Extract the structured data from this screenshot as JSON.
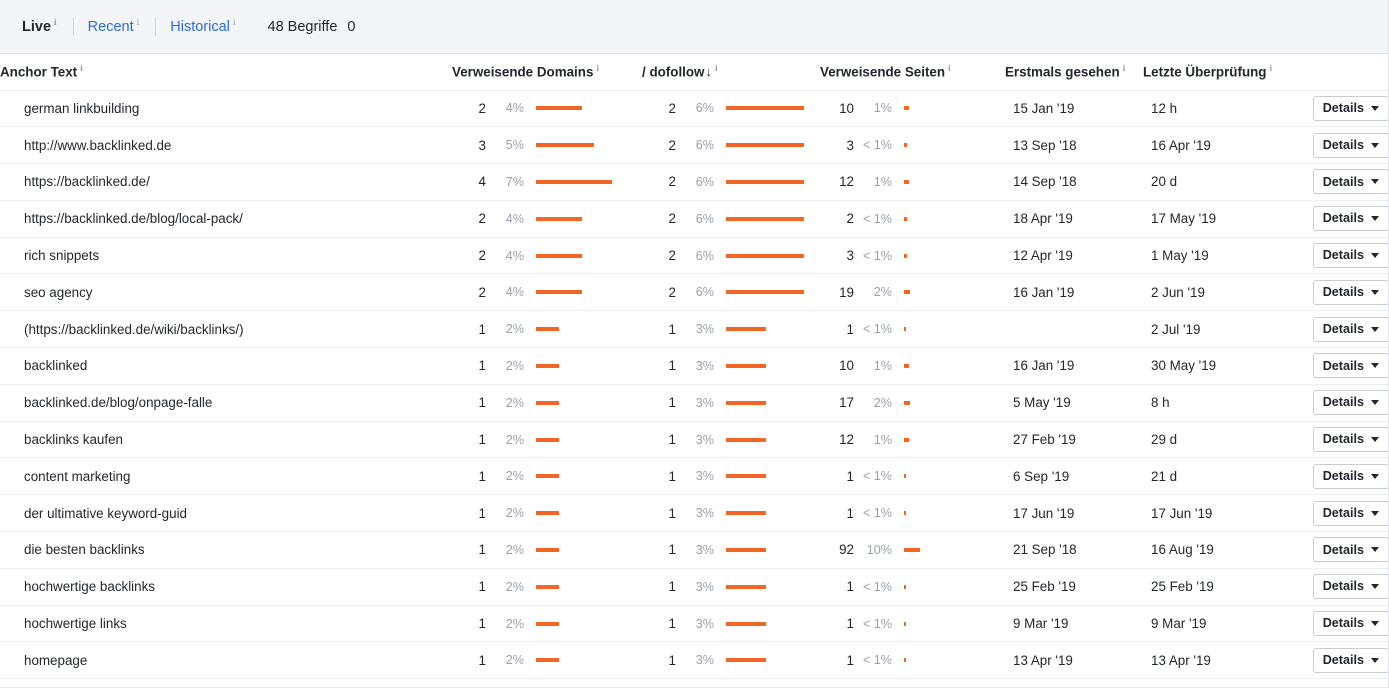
{
  "toolbar": {
    "tabs": [
      {
        "label": "Live",
        "active": true
      },
      {
        "label": "Recent",
        "active": false
      },
      {
        "label": "Historical",
        "active": false
      }
    ],
    "count_label": "48 Begriffe",
    "count_zero": "0"
  },
  "table": {
    "columns": [
      {
        "key": "anchor",
        "label": "Anchor Text",
        "info": true,
        "sorted": false
      },
      {
        "key": "rd",
        "label": "Verweisende Domains",
        "info": true,
        "sorted": false
      },
      {
        "key": "df",
        "label": "/ dofollow",
        "info": true,
        "sorted": true,
        "sort_dir": "↓"
      },
      {
        "key": "rp",
        "label": "Verweisende Seiten",
        "info": true,
        "sorted": false
      },
      {
        "key": "first",
        "label": "Erstmals gesehen",
        "info": true,
        "sorted": false
      },
      {
        "key": "last",
        "label": "Letzte Überprüfung",
        "info": true,
        "sorted": false
      },
      {
        "key": "actions",
        "label": "",
        "info": false,
        "sorted": false
      }
    ],
    "action_label": "Details",
    "rows": [
      {
        "anchor": "german linkbuilding",
        "rd": "2",
        "rd_pct": "4%",
        "rd_bar": 46,
        "df": "2",
        "df_pct": "6%",
        "df_bar": 78,
        "rp": "10",
        "rp_pct": "1%",
        "rp_bar": 5,
        "first": "15 Jan '19",
        "last": "12 h"
      },
      {
        "anchor": "http://www.backlinked.de",
        "rd": "3",
        "rd_pct": "5%",
        "rd_bar": 58,
        "df": "2",
        "df_pct": "6%",
        "df_bar": 78,
        "rp": "3",
        "rp_pct": "< 1%",
        "rp_bar": 3,
        "first": "13 Sep '18",
        "last": "16 Apr '19"
      },
      {
        "anchor": "https://backlinked.de/",
        "rd": "4",
        "rd_pct": "7%",
        "rd_bar": 76,
        "df": "2",
        "df_pct": "6%",
        "df_bar": 78,
        "rp": "12",
        "rp_pct": "1%",
        "rp_bar": 5,
        "first": "14 Sep '18",
        "last": "20 d"
      },
      {
        "anchor": "https://backlinked.de/blog/local-pack/",
        "rd": "2",
        "rd_pct": "4%",
        "rd_bar": 46,
        "df": "2",
        "df_pct": "6%",
        "df_bar": 78,
        "rp": "2",
        "rp_pct": "< 1%",
        "rp_bar": 3,
        "first": "18 Apr '19",
        "last": "17 May '19"
      },
      {
        "anchor": "rich snippets",
        "rd": "2",
        "rd_pct": "4%",
        "rd_bar": 46,
        "df": "2",
        "df_pct": "6%",
        "df_bar": 78,
        "rp": "3",
        "rp_pct": "< 1%",
        "rp_bar": 3,
        "first": "12 Apr '19",
        "last": "1 May '19"
      },
      {
        "anchor": "seo agency",
        "rd": "2",
        "rd_pct": "4%",
        "rd_bar": 46,
        "df": "2",
        "df_pct": "6%",
        "df_bar": 78,
        "rp": "19",
        "rp_pct": "2%",
        "rp_bar": 6,
        "first": "16 Jan '19",
        "last": "2 Jun '19"
      },
      {
        "anchor": "(https://backlinked.de/wiki/backlinks/)",
        "rd": "1",
        "rd_pct": "2%",
        "rd_bar": 23,
        "df": "1",
        "df_pct": "3%",
        "df_bar": 40,
        "rp": "1",
        "rp_pct": "< 1%",
        "rp_bar": 2,
        "first": "",
        "last": "2 Jul '19"
      },
      {
        "anchor": "backlinked",
        "rd": "1",
        "rd_pct": "2%",
        "rd_bar": 23,
        "df": "1",
        "df_pct": "3%",
        "df_bar": 40,
        "rp": "10",
        "rp_pct": "1%",
        "rp_bar": 5,
        "first": "16 Jan '19",
        "last": "30 May '19"
      },
      {
        "anchor": "backlinked.de/blog/onpage-falle",
        "rd": "1",
        "rd_pct": "2%",
        "rd_bar": 23,
        "df": "1",
        "df_pct": "3%",
        "df_bar": 40,
        "rp": "17",
        "rp_pct": "2%",
        "rp_bar": 6,
        "first": "5 May '19",
        "last": "8 h"
      },
      {
        "anchor": "backlinks kaufen",
        "rd": "1",
        "rd_pct": "2%",
        "rd_bar": 23,
        "df": "1",
        "df_pct": "3%",
        "df_bar": 40,
        "rp": "12",
        "rp_pct": "1%",
        "rp_bar": 5,
        "first": "27 Feb '19",
        "last": "29 d"
      },
      {
        "anchor": "content marketing",
        "rd": "1",
        "rd_pct": "2%",
        "rd_bar": 23,
        "df": "1",
        "df_pct": "3%",
        "df_bar": 40,
        "rp": "1",
        "rp_pct": "< 1%",
        "rp_bar": 2,
        "first": "6 Sep '19",
        "last": "21 d"
      },
      {
        "anchor": "der ultimative keyword-guid",
        "rd": "1",
        "rd_pct": "2%",
        "rd_bar": 23,
        "df": "1",
        "df_pct": "3%",
        "df_bar": 40,
        "rp": "1",
        "rp_pct": "< 1%",
        "rp_bar": 2,
        "first": "17 Jun '19",
        "last": "17 Jun '19"
      },
      {
        "anchor": "die besten backlinks",
        "rd": "1",
        "rd_pct": "2%",
        "rd_bar": 23,
        "df": "1",
        "df_pct": "3%",
        "df_bar": 40,
        "rp": "92",
        "rp_pct": "10%",
        "rp_bar": 16,
        "first": "21 Sep '18",
        "last": "16 Aug '19"
      },
      {
        "anchor": "hochwertige backlinks",
        "rd": "1",
        "rd_pct": "2%",
        "rd_bar": 23,
        "df": "1",
        "df_pct": "3%",
        "df_bar": 40,
        "rp": "1",
        "rp_pct": "< 1%",
        "rp_bar": 2,
        "first": "25 Feb '19",
        "last": "25 Feb '19"
      },
      {
        "anchor": "hochwertige links",
        "rd": "1",
        "rd_pct": "2%",
        "rd_bar": 23,
        "df": "1",
        "df_pct": "3%",
        "df_bar": 40,
        "rp": "1",
        "rp_pct": "< 1%",
        "rp_bar": 2,
        "first": "9 Mar '19",
        "last": "9 Mar '19"
      },
      {
        "anchor": "homepage",
        "rd": "1",
        "rd_pct": "2%",
        "rd_bar": 23,
        "df": "1",
        "df_pct": "3%",
        "df_bar": 40,
        "rp": "1",
        "rp_pct": "< 1%",
        "rp_bar": 2,
        "first": "13 Apr '19",
        "last": "13 Apr '19"
      }
    ]
  },
  "colors": {
    "bar": "#f26522",
    "link": "#2b6cd4",
    "toolbar_bg": "#f4f5f8",
    "text": "#23272c",
    "muted": "#9aa0aa"
  }
}
